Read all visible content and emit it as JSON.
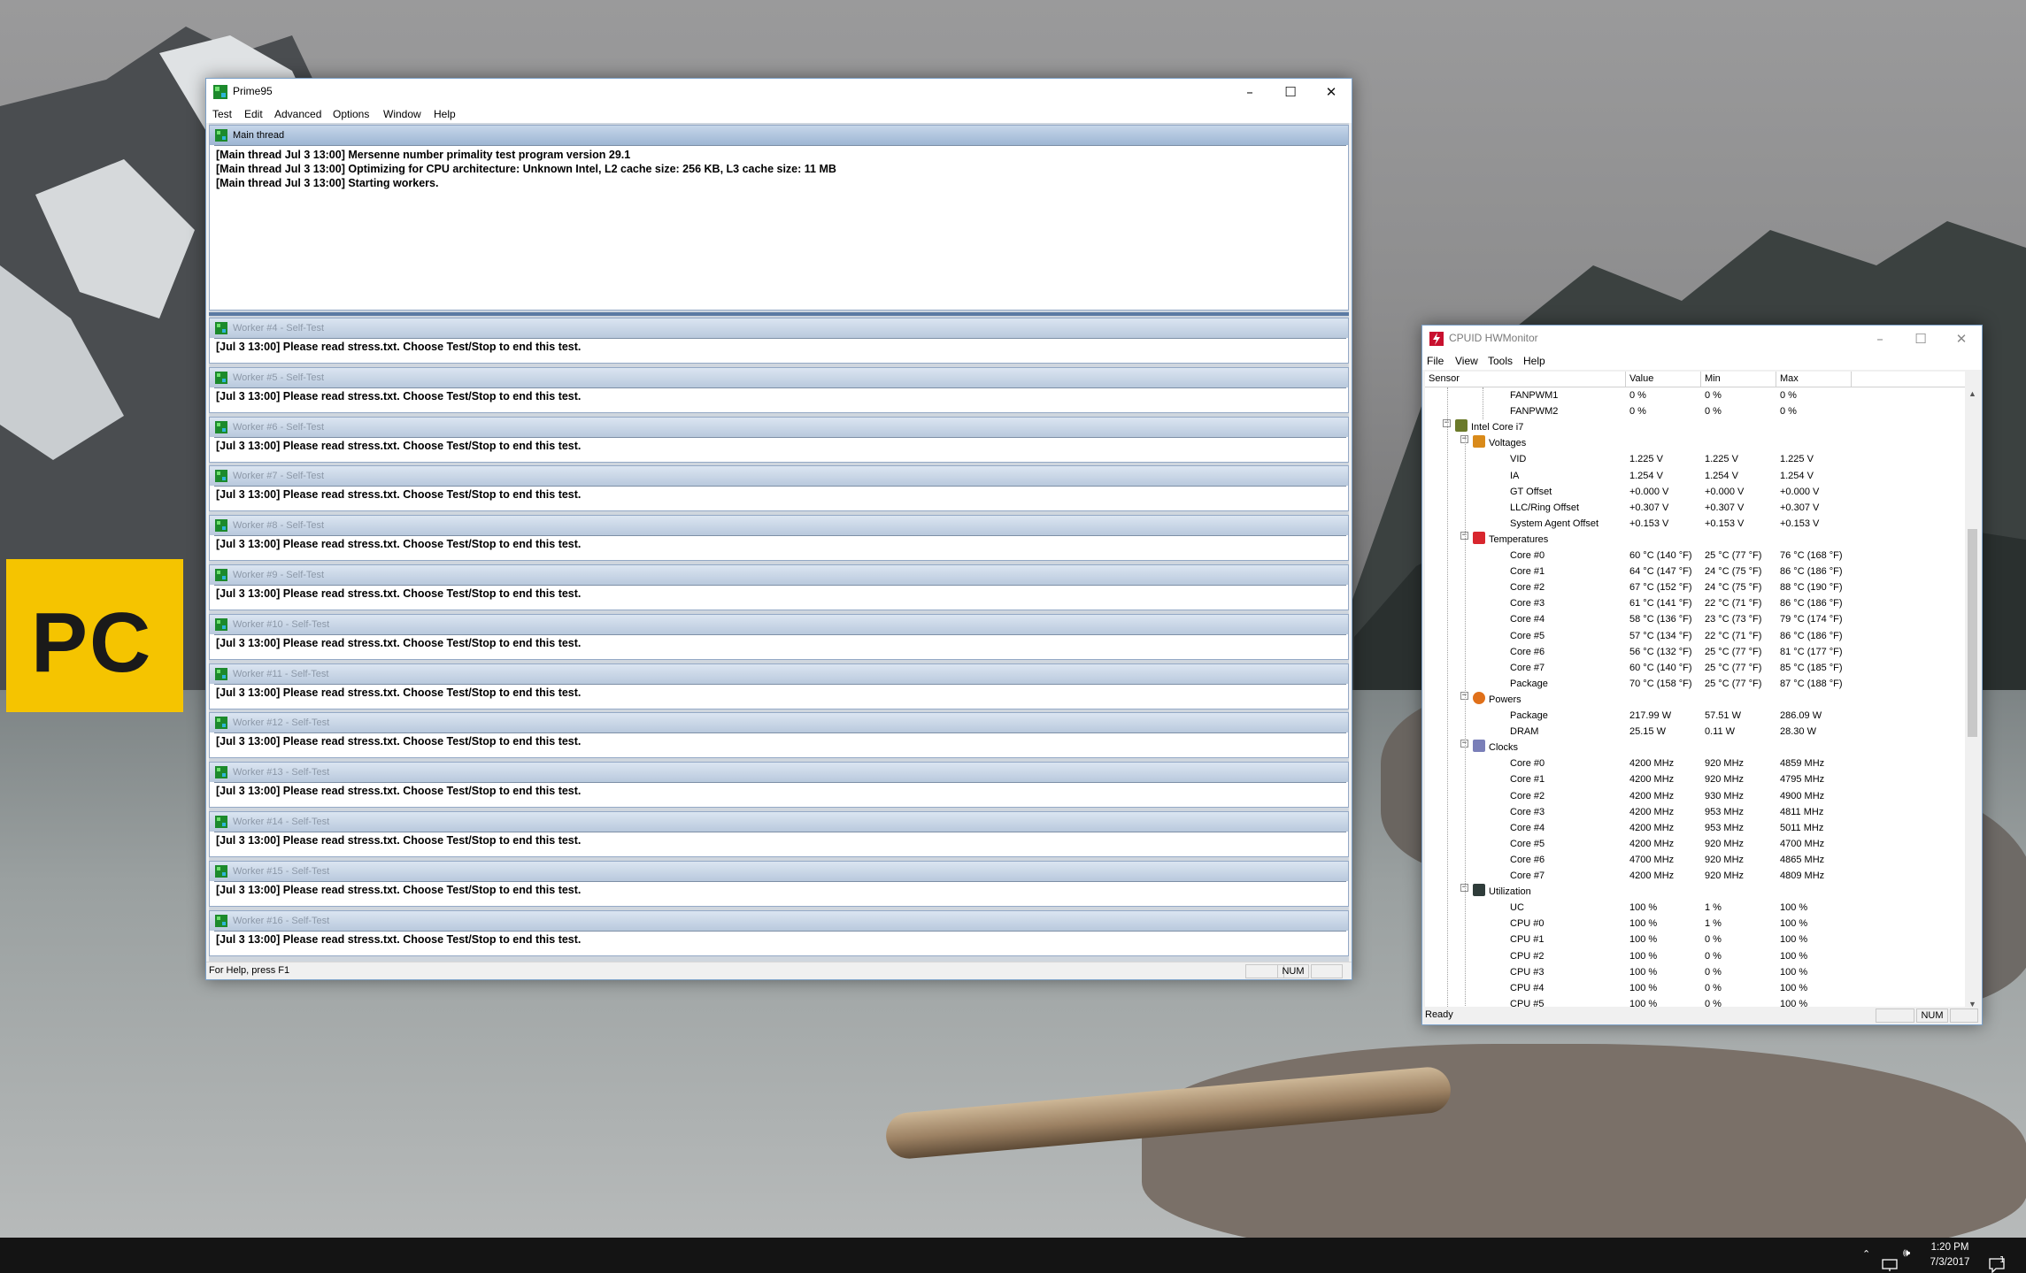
{
  "prime95": {
    "title": "Prime95",
    "menu": [
      "Test",
      "Edit",
      "Advanced",
      "Options",
      "Window",
      "Help"
    ],
    "main_thread": {
      "caption": "Main thread",
      "lines": [
        "[Main thread Jul 3 13:00] Mersenne number primality test program version 29.1",
        "[Main thread Jul 3 13:00] Optimizing for CPU architecture: Unknown Intel, L2 cache size: 256 KB, L3 cache size: 11 MB",
        "[Main thread Jul 3 13:00] Starting workers."
      ]
    },
    "workers": [
      {
        "caption": "Worker #4 - Self-Test",
        "line": "[Jul 3 13:00] Please read stress.txt.  Choose Test/Stop to end this test."
      },
      {
        "caption": "Worker #5 - Self-Test",
        "line": "[Jul 3 13:00] Please read stress.txt.  Choose Test/Stop to end this test."
      },
      {
        "caption": "Worker #6 - Self-Test",
        "line": "[Jul 3 13:00] Please read stress.txt.  Choose Test/Stop to end this test."
      },
      {
        "caption": "Worker #7 - Self-Test",
        "line": "[Jul 3 13:00] Please read stress.txt.  Choose Test/Stop to end this test."
      },
      {
        "caption": "Worker #8 - Self-Test",
        "line": "[Jul 3 13:00] Please read stress.txt.  Choose Test/Stop to end this test."
      },
      {
        "caption": "Worker #9 - Self-Test",
        "line": "[Jul 3 13:00] Please read stress.txt.  Choose Test/Stop to end this test."
      },
      {
        "caption": "Worker #10 - Self-Test",
        "line": "[Jul 3 13:00] Please read stress.txt.  Choose Test/Stop to end this test."
      },
      {
        "caption": "Worker #11 - Self-Test",
        "line": "[Jul 3 13:00] Please read stress.txt.  Choose Test/Stop to end this test."
      },
      {
        "caption": "Worker #12 - Self-Test",
        "line": "[Jul 3 13:00] Please read stress.txt.  Choose Test/Stop to end this test."
      },
      {
        "caption": "Worker #13 - Self-Test",
        "line": "[Jul 3 13:00] Please read stress.txt.  Choose Test/Stop to end this test."
      },
      {
        "caption": "Worker #14 - Self-Test",
        "line": "[Jul 3 13:00] Please read stress.txt.  Choose Test/Stop to end this test."
      },
      {
        "caption": "Worker #15 - Self-Test",
        "line": "[Jul 3 13:00] Please read stress.txt.  Choose Test/Stop to end this test."
      },
      {
        "caption": "Worker #16 - Self-Test",
        "line": "[Jul 3 13:00] Please read stress.txt.  Choose Test/Stop to end this test."
      }
    ],
    "status": {
      "help": "For Help, press F1",
      "num": "NUM"
    }
  },
  "hwmonitor": {
    "title": "CPUID HWMonitor",
    "menu": [
      "File",
      "View",
      "Tools",
      "Help"
    ],
    "columns": [
      "Sensor",
      "Value",
      "Min",
      "Max"
    ],
    "rows": [
      {
        "level": 3,
        "icon": "",
        "label": "FANPWM1",
        "value": "0 %",
        "min": "0 %",
        "max": "0 %"
      },
      {
        "level": 3,
        "icon": "",
        "label": "FANPWM2",
        "value": "0 %",
        "min": "0 %",
        "max": "0 %"
      },
      {
        "level": 1,
        "icon": "chip-icon",
        "label": "Intel Core i7",
        "value": "",
        "min": "",
        "max": ""
      },
      {
        "level": 2,
        "icon": "voltage-icon",
        "label": "Voltages",
        "value": "",
        "min": "",
        "max": ""
      },
      {
        "level": 3,
        "icon": "",
        "label": "VID",
        "value": "1.225 V",
        "min": "1.225 V",
        "max": "1.225 V"
      },
      {
        "level": 3,
        "icon": "",
        "label": "IA",
        "value": "1.254 V",
        "min": "1.254 V",
        "max": "1.254 V"
      },
      {
        "level": 3,
        "icon": "",
        "label": "GT Offset",
        "value": "+0.000 V",
        "min": "+0.000 V",
        "max": "+0.000 V"
      },
      {
        "level": 3,
        "icon": "",
        "label": "LLC/Ring Offset",
        "value": "+0.307 V",
        "min": "+0.307 V",
        "max": "+0.307 V"
      },
      {
        "level": 3,
        "icon": "",
        "label": "System Agent Offset",
        "value": "+0.153 V",
        "min": "+0.153 V",
        "max": "+0.153 V"
      },
      {
        "level": 2,
        "icon": "thermometer-icon",
        "label": "Temperatures",
        "value": "",
        "min": "",
        "max": ""
      },
      {
        "level": 3,
        "icon": "",
        "label": "Core #0",
        "value": "60 °C  (140 °F)",
        "min": "25 °C  (77 °F)",
        "max": "76 °C  (168 °F)"
      },
      {
        "level": 3,
        "icon": "",
        "label": "Core #1",
        "value": "64 °C  (147 °F)",
        "min": "24 °C  (75 °F)",
        "max": "86 °C  (186 °F)"
      },
      {
        "level": 3,
        "icon": "",
        "label": "Core #2",
        "value": "67 °C  (152 °F)",
        "min": "24 °C  (75 °F)",
        "max": "88 °C  (190 °F)"
      },
      {
        "level": 3,
        "icon": "",
        "label": "Core #3",
        "value": "61 °C  (141 °F)",
        "min": "22 °C  (71 °F)",
        "max": "86 °C  (186 °F)"
      },
      {
        "level": 3,
        "icon": "",
        "label": "Core #4",
        "value": "58 °C  (136 °F)",
        "min": "23 °C  (73 °F)",
        "max": "79 °C  (174 °F)"
      },
      {
        "level": 3,
        "icon": "",
        "label": "Core #5",
        "value": "57 °C  (134 °F)",
        "min": "22 °C  (71 °F)",
        "max": "86 °C  (186 °F)"
      },
      {
        "level": 3,
        "icon": "",
        "label": "Core #6",
        "value": "56 °C  (132 °F)",
        "min": "25 °C  (77 °F)",
        "max": "81 °C  (177 °F)"
      },
      {
        "level": 3,
        "icon": "",
        "label": "Core #7",
        "value": "60 °C  (140 °F)",
        "min": "25 °C  (77 °F)",
        "max": "85 °C  (185 °F)"
      },
      {
        "level": 3,
        "icon": "",
        "label": "Package",
        "value": "70 °C  (158 °F)",
        "min": "25 °C  (77 °F)",
        "max": "87 °C  (188 °F)"
      },
      {
        "level": 2,
        "icon": "power-icon",
        "label": "Powers",
        "value": "",
        "min": "",
        "max": ""
      },
      {
        "level": 3,
        "icon": "",
        "label": "Package",
        "value": "217.99 W",
        "min": "57.51 W",
        "max": "286.09 W"
      },
      {
        "level": 3,
        "icon": "",
        "label": "DRAM",
        "value": "25.15 W",
        "min": "0.11 W",
        "max": "28.30 W"
      },
      {
        "level": 2,
        "icon": "clock-icon",
        "label": "Clocks",
        "value": "",
        "min": "",
        "max": ""
      },
      {
        "level": 3,
        "icon": "",
        "label": "Core #0",
        "value": "4200 MHz",
        "min": "920 MHz",
        "max": "4859 MHz"
      },
      {
        "level": 3,
        "icon": "",
        "label": "Core #1",
        "value": "4200 MHz",
        "min": "920 MHz",
        "max": "4795 MHz"
      },
      {
        "level": 3,
        "icon": "",
        "label": "Core #2",
        "value": "4200 MHz",
        "min": "930 MHz",
        "max": "4900 MHz"
      },
      {
        "level": 3,
        "icon": "",
        "label": "Core #3",
        "value": "4200 MHz",
        "min": "953 MHz",
        "max": "4811 MHz"
      },
      {
        "level": 3,
        "icon": "",
        "label": "Core #4",
        "value": "4200 MHz",
        "min": "953 MHz",
        "max": "5011 MHz"
      },
      {
        "level": 3,
        "icon": "",
        "label": "Core #5",
        "value": "4200 MHz",
        "min": "920 MHz",
        "max": "4700 MHz"
      },
      {
        "level": 3,
        "icon": "",
        "label": "Core #6",
        "value": "4700 MHz",
        "min": "920 MHz",
        "max": "4865 MHz"
      },
      {
        "level": 3,
        "icon": "",
        "label": "Core #7",
        "value": "4200 MHz",
        "min": "920 MHz",
        "max": "4809 MHz"
      },
      {
        "level": 2,
        "icon": "utilization-icon",
        "label": "Utilization",
        "value": "",
        "min": "",
        "max": ""
      },
      {
        "level": 3,
        "icon": "",
        "label": "UC",
        "value": "100 %",
        "min": "1 %",
        "max": "100 %"
      },
      {
        "level": 3,
        "icon": "",
        "label": "CPU #0",
        "value": "100 %",
        "min": "1 %",
        "max": "100 %"
      },
      {
        "level": 3,
        "icon": "",
        "label": "CPU #1",
        "value": "100 %",
        "min": "0 %",
        "max": "100 %"
      },
      {
        "level": 3,
        "icon": "",
        "label": "CPU #2",
        "value": "100 %",
        "min": "0 %",
        "max": "100 %"
      },
      {
        "level": 3,
        "icon": "",
        "label": "CPU #3",
        "value": "100 %",
        "min": "0 %",
        "max": "100 %"
      },
      {
        "level": 3,
        "icon": "",
        "label": "CPU #4",
        "value": "100 %",
        "min": "0 %",
        "max": "100 %"
      },
      {
        "level": 3,
        "icon": "",
        "label": "CPU #5",
        "value": "100 %",
        "min": "0 %",
        "max": "100 %"
      }
    ],
    "status": {
      "ready": "Ready",
      "num": "NUM"
    }
  },
  "desktop": {
    "logo_text": "PC",
    "logo_color": "#f5c400"
  },
  "taskbar": {
    "time": "1:20 PM",
    "date": "7/3/2017",
    "notification_count": "1"
  }
}
